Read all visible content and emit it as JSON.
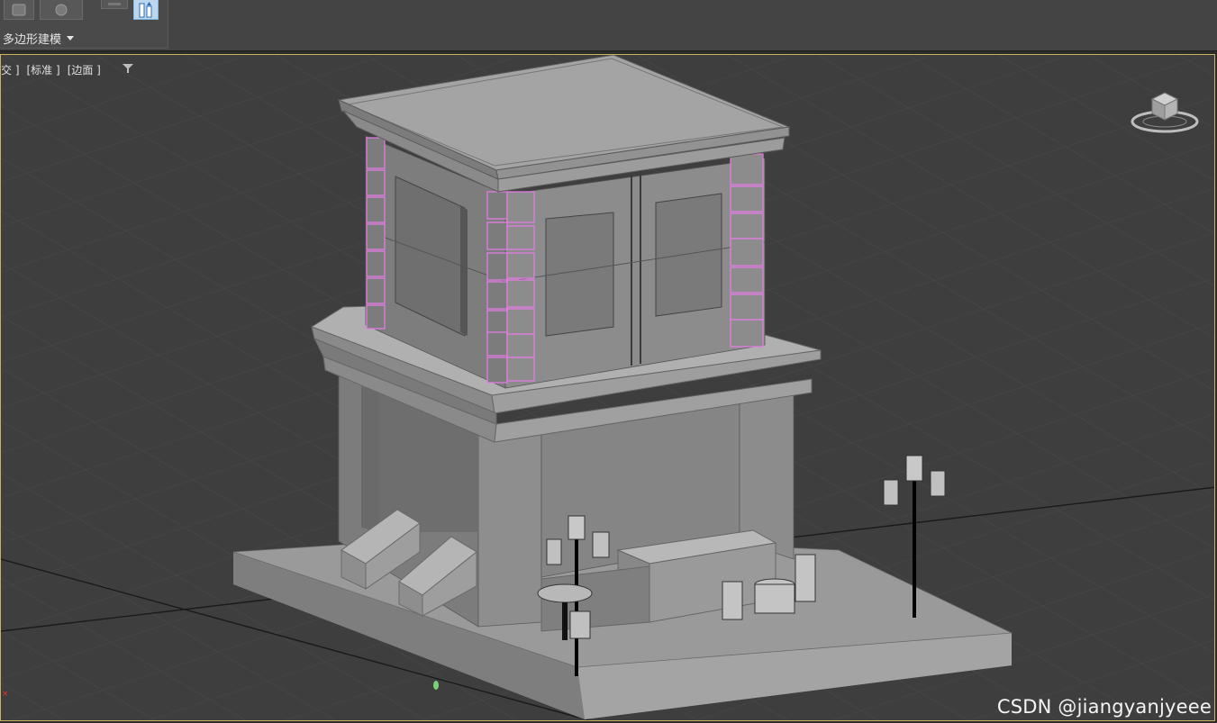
{
  "ribbon": {
    "panel_label": "多边形建模",
    "active_tool_icon": "swift-loop-icon",
    "tool_icons": [
      "graphite-icon",
      "sphere-icon",
      "flat-tool-icon",
      "swift-loop-icon"
    ]
  },
  "viewport": {
    "labels": [
      "交 ]",
      "[标准 ]",
      "[边面 ]"
    ],
    "filter_icon": "filter-icon",
    "viewcube_icon": "viewcube-icon",
    "border_color": "#c8b25a",
    "background_color": "#3d3d3d",
    "selection_color": "#e87ce8"
  },
  "watermark": "CSDN @jiangyanjyeee"
}
